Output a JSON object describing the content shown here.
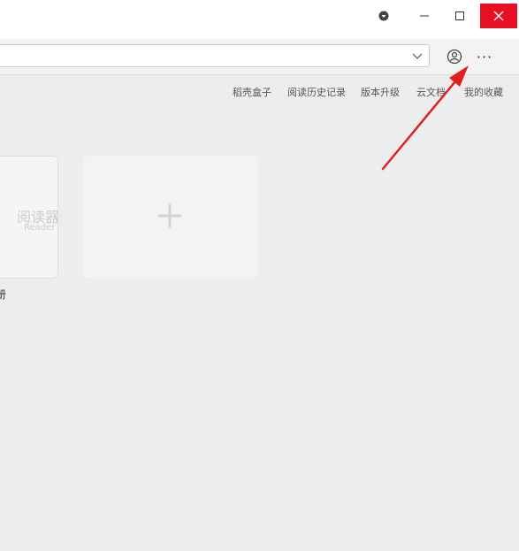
{
  "window": {
    "skin_icon": "skin-icon",
    "minimize_icon": "minimize-icon",
    "maximize_icon": "maximize-icon",
    "close_icon": "close-icon",
    "close_color": "#e81123"
  },
  "toolbar": {
    "address_value": "",
    "dropdown_icon": "chevron-down-icon",
    "user_icon": "user-icon",
    "more_label": "···"
  },
  "nav": {
    "items": [
      "稻壳盒子",
      "阅读历史记录",
      "版本升级",
      "云文档",
      "我的收藏"
    ]
  },
  "cards": {
    "reader_title": "阅读器",
    "reader_subtitle": "Reader",
    "reader_caption": "册",
    "add_icon": "plus-icon"
  },
  "annotation": {
    "arrow_color": "#e02020"
  }
}
